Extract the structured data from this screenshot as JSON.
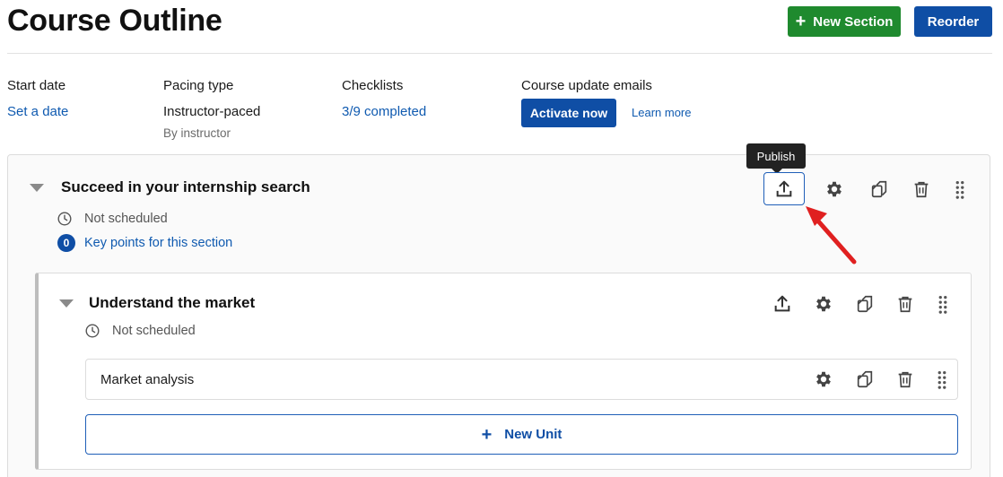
{
  "page": {
    "title": "Course Outline"
  },
  "header": {
    "new_section_label": "New Section",
    "reorder_label": "Reorder"
  },
  "info": {
    "start_date": {
      "label": "Start date",
      "link": "Set a date"
    },
    "pacing": {
      "label": "Pacing type",
      "value": "Instructor-paced",
      "sub": "By instructor"
    },
    "checklists": {
      "label": "Checklists",
      "link": "3/9 completed"
    },
    "emails": {
      "label": "Course update emails",
      "button": "Activate now",
      "link": "Learn more"
    }
  },
  "section": {
    "title": "Succeed in your internship search",
    "schedule": "Not scheduled",
    "key_points_count": "0",
    "key_points_label": "Key points for this section",
    "tooltip": "Publish"
  },
  "subsection": {
    "title": "Understand the market",
    "schedule": "Not scheduled"
  },
  "unit": {
    "title": "Market analysis"
  },
  "new_unit_label": "New Unit",
  "icons": [
    "caret-down-icon",
    "clock-icon",
    "publish-icon",
    "gear-icon",
    "duplicate-icon",
    "trash-icon",
    "drag-handle-icon",
    "plus-icon"
  ],
  "colors": {
    "primary": "#0f4ea5",
    "success": "#1f8a2e",
    "link": "#0f5ab0",
    "annotation_arrow": "#e02020"
  }
}
